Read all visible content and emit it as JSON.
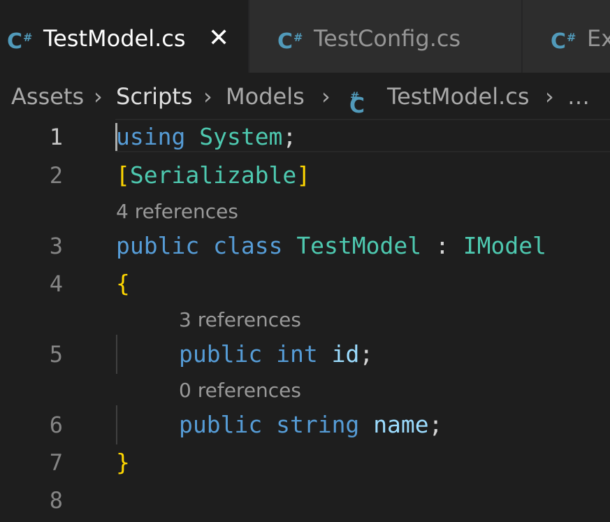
{
  "tabs": [
    {
      "label": "TestModel.cs",
      "icon": "csharp-icon",
      "active": true,
      "close": "✕"
    },
    {
      "label": "TestConfig.cs",
      "icon": "csharp-icon",
      "active": false
    },
    {
      "label": "Ex",
      "icon": "csharp-icon",
      "active": false
    }
  ],
  "csharp_icon_text": {
    "c": "C",
    "hash": "#"
  },
  "breadcrumbs": {
    "items": [
      "Assets",
      "Scripts",
      "Models",
      "TestModel.cs",
      "…"
    ],
    "separator": "›"
  },
  "editor": {
    "line_numbers": [
      "1",
      "2",
      "3",
      "4",
      "5",
      "6",
      "7",
      "8"
    ],
    "lines": {
      "l1": {
        "kw": "using",
        "type": "System",
        "punct": ";"
      },
      "l2": {
        "open": "[",
        "attr": "Serializable",
        "close": "]"
      },
      "l3": {
        "kw1": "public",
        "kw2": "class",
        "name": "TestModel",
        "colon": " : ",
        "iface": "IModel"
      },
      "l4": {
        "brace": "{"
      },
      "l5": {
        "kw1": "public",
        "kw2": "int",
        "var": "id",
        "punct": ";"
      },
      "l6": {
        "kw1": "public",
        "kw2": "string",
        "var": "name",
        "punct": ";"
      },
      "l7": {
        "brace": "}"
      }
    },
    "codelens": {
      "class_refs": "4 references",
      "id_refs": "3 references",
      "name_refs": "0 references"
    }
  },
  "colors": {
    "keyword": "#569cd6",
    "type": "#4ec9b0",
    "variable": "#9cdcfe",
    "brace": "#ffd700",
    "csharp_icon": "#519aba"
  }
}
